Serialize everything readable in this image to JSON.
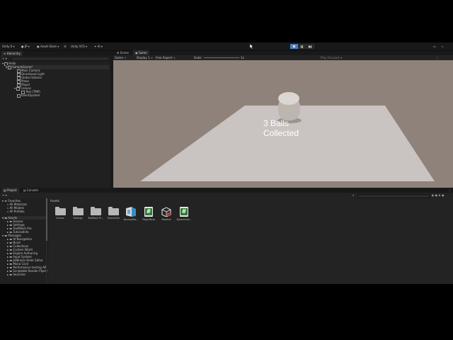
{
  "toolbar": {
    "account": "Unity 6",
    "account_user": "JP",
    "asset_store": "Asset Store",
    "version_control": "Unity VCS",
    "ai": "AI"
  },
  "hierarchy": {
    "tab": "Hierarchy",
    "items": [
      {
        "label": "Hello"
      },
      {
        "label": "SampleScene*"
      },
      {
        "label": "Main Camera"
      },
      {
        "label": "Directional Light"
      },
      {
        "label": "Global Volume"
      },
      {
        "label": "Plane"
      },
      {
        "label": "Player"
      },
      {
        "label": "Canvas"
      },
      {
        "label": "Text (TMP)"
      },
      {
        "label": "EventSystem"
      }
    ]
  },
  "scene_view": {
    "tabs": [
      "Scene",
      "Game"
    ],
    "display": "Game",
    "display_num": "Display 1",
    "aspect": "Free Aspect",
    "scale_label": "Scale",
    "scale_value": "1x",
    "play_focused": "Play Focused",
    "overlay_text_line1": "3 Balls",
    "overlay_text_line2": "Collected"
  },
  "project": {
    "tabs": [
      "Project",
      "Console"
    ],
    "favorites_label": "Favorites",
    "favorites": [
      "All Materials",
      "All Models",
      "All Prefabs"
    ],
    "assets_label": "Assets",
    "assets_children": [
      "Scenes",
      "Settings",
      "TextMesh Pro",
      "TutorialInfo"
    ],
    "packages_label": "Packages",
    "packages": [
      "AI Navigation",
      "Burst",
      "Collections",
      "Custom NUnit",
      "Engine Authoring",
      "Input System",
      "JetBrains Rider Editor",
      "Mono Cecil",
      "Performance testing API",
      "Scriptable Render Pipeline",
      "Searcher"
    ],
    "breadcrumb": "Assets",
    "grid_items": [
      {
        "label": "Scenes",
        "icon": "folder-icon"
      },
      {
        "label": "Settings",
        "icon": "folder-icon"
      },
      {
        "label": "TextMesh Pr...",
        "icon": "folder-icon"
      },
      {
        "label": "TutorialInfo",
        "icon": "folder-icon"
      },
      {
        "label": "BouncyMat...",
        "icon": "material-icon"
      },
      {
        "label": "PlayerMove",
        "icon": "csharp-script-icon"
      },
      {
        "label": "Readme",
        "icon": "readme-asset-icon"
      },
      {
        "label": "SphereColli...",
        "icon": "csharp-script-icon"
      }
    ]
  },
  "colors": {
    "scene_bg": "#8e827a",
    "plane": "#c9c3c1",
    "accent_play": "#4c7fbf",
    "script_green": "#2e7d32"
  }
}
